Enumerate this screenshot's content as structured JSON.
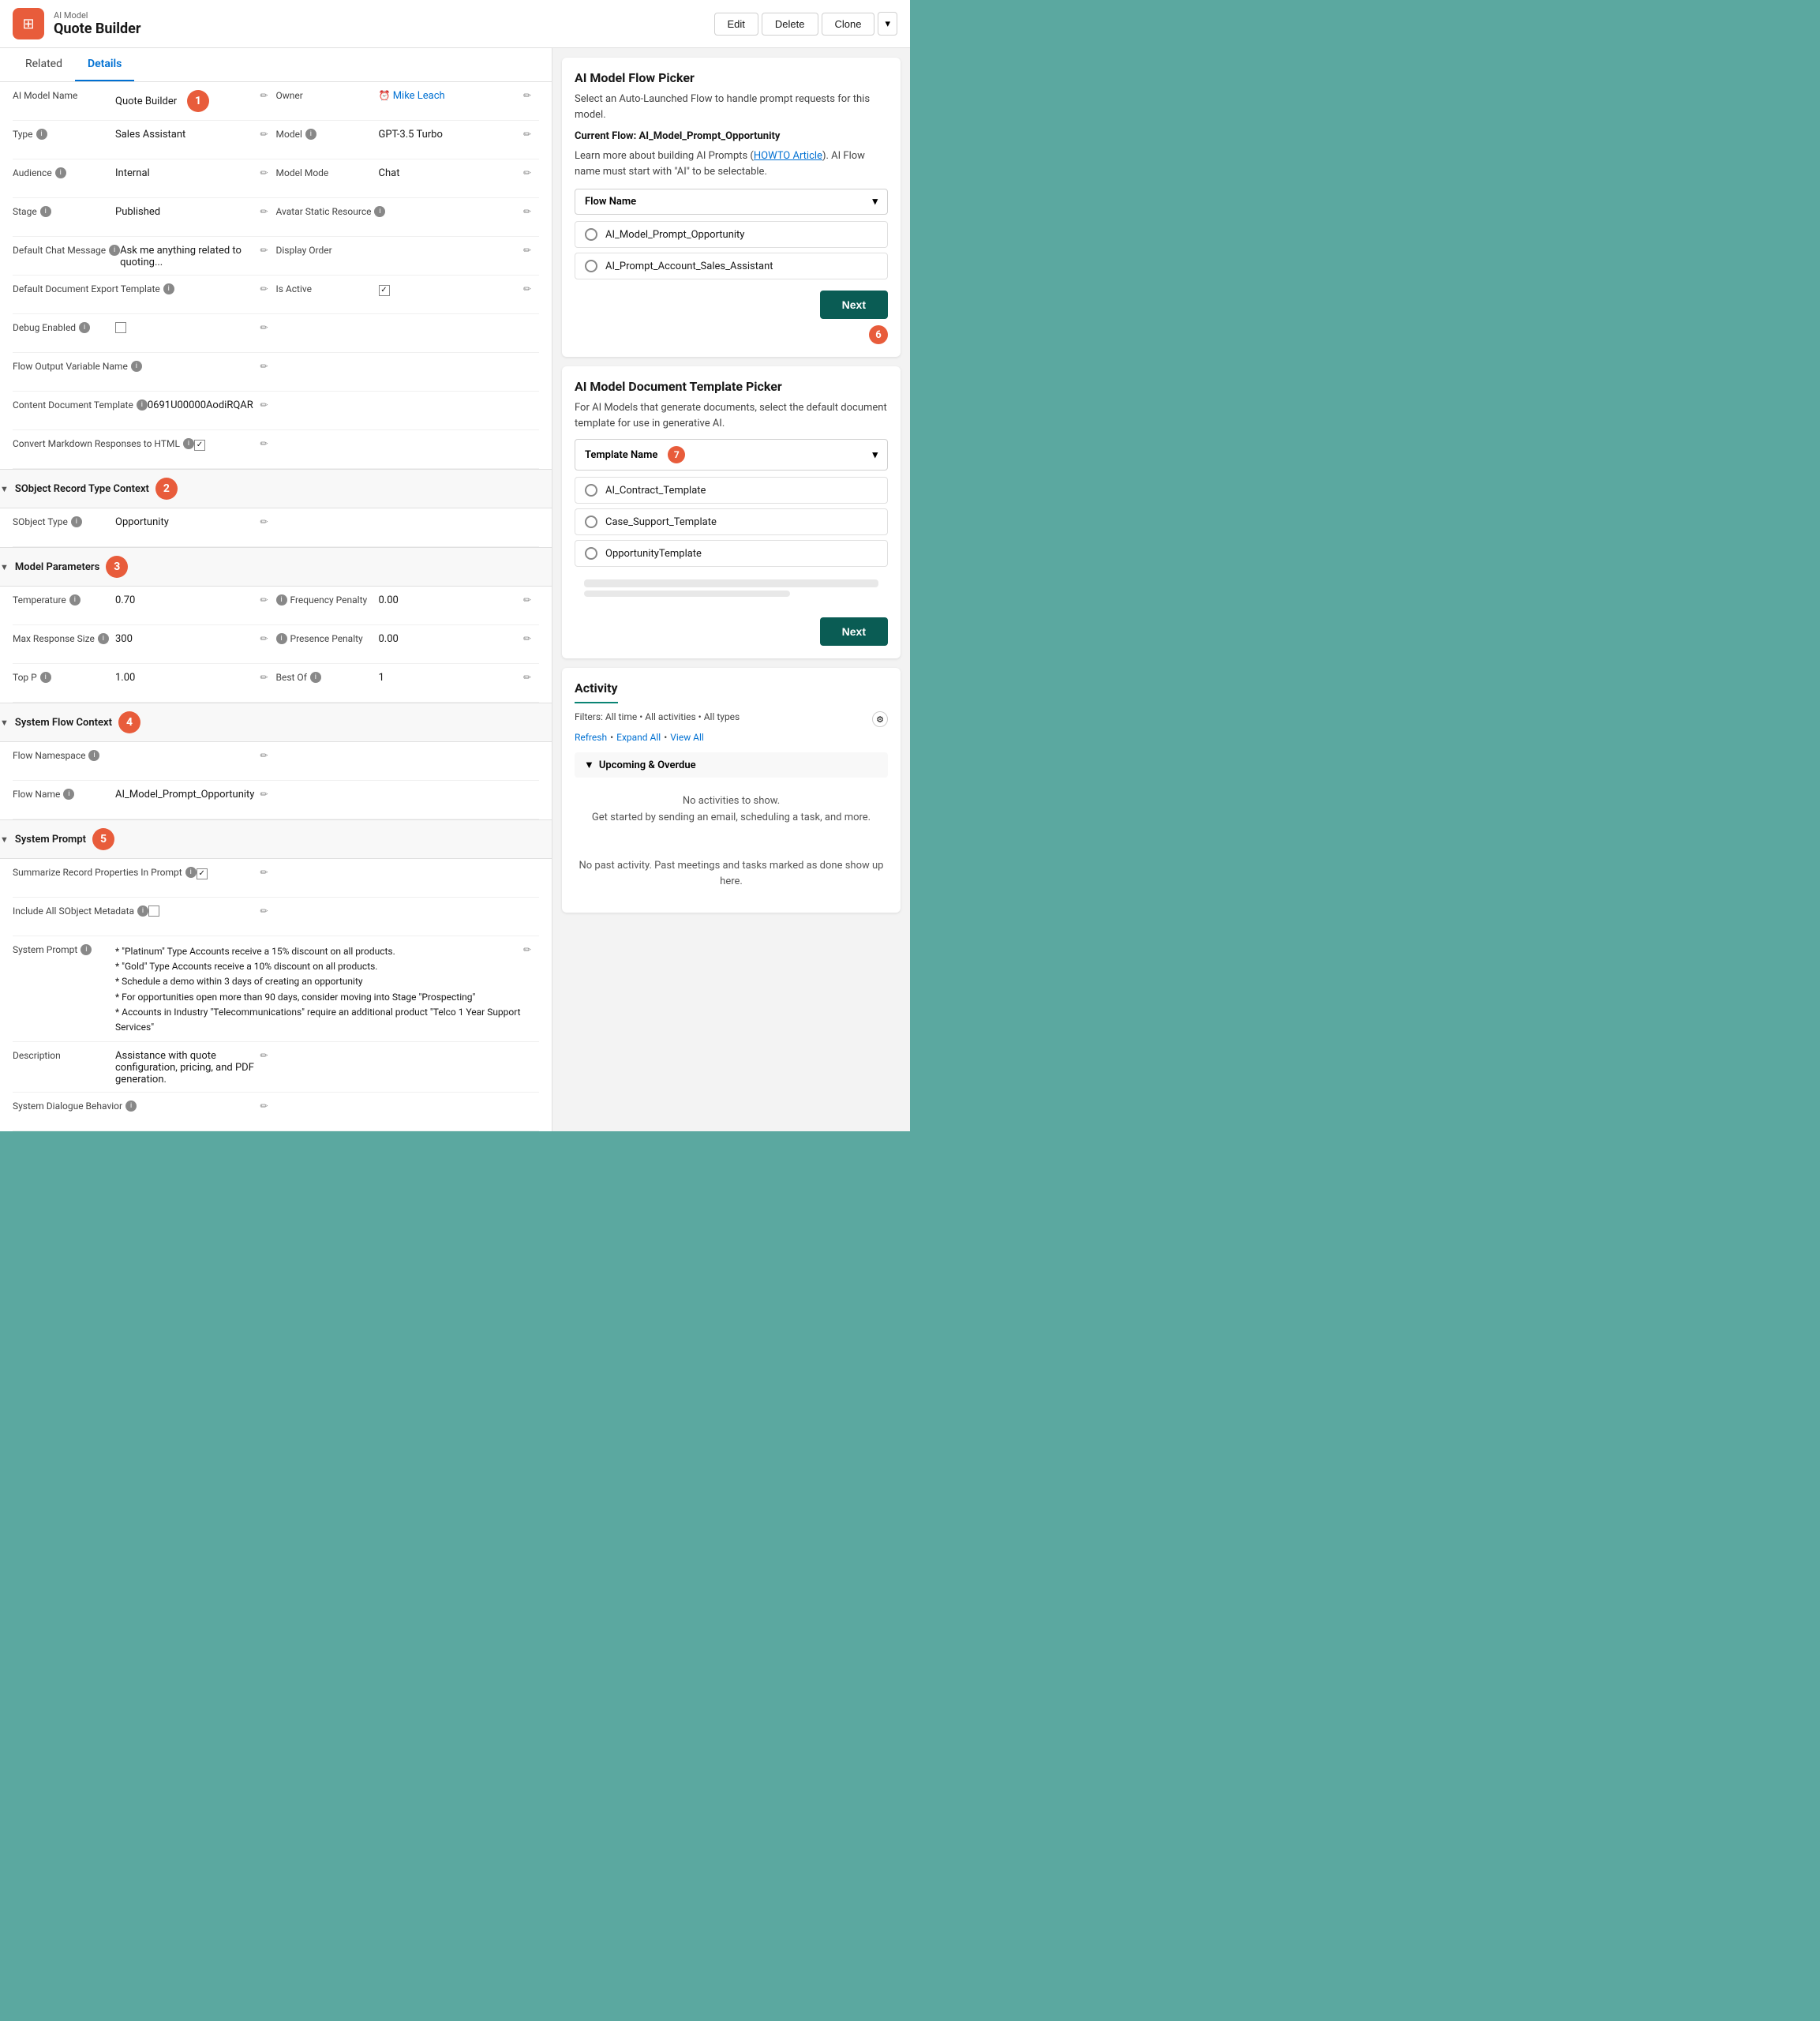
{
  "header": {
    "app_subtitle": "AI Model",
    "app_title": "Quote Builder",
    "app_icon": "⊞",
    "buttons": {
      "edit": "Edit",
      "delete": "Delete",
      "clone": "Clone"
    }
  },
  "tabs": {
    "related": "Related",
    "details": "Details",
    "active": "details"
  },
  "fields": {
    "ai_model_name_label": "AI Model Name",
    "ai_model_name_value": "Quote Builder",
    "type_label": "Type",
    "type_value": "Sales Assistant",
    "audience_label": "Audience",
    "audience_value": "Internal",
    "stage_label": "Stage",
    "stage_value": "Published",
    "default_chat_label": "Default Chat Message",
    "default_chat_value": "Ask me anything related to quoting...",
    "default_doc_export_label": "Default Document Export Template",
    "debug_enabled_label": "Debug Enabled",
    "flow_output_label": "Flow Output Variable Name",
    "content_doc_label": "Content Document Template",
    "content_doc_value": "0691U00000AodiRQAR",
    "convert_markdown_label": "Convert Markdown Responses to HTML",
    "owner_label": "Owner",
    "owner_value": "Mike Leach",
    "model_label": "Model",
    "model_value": "GPT-3.5 Turbo",
    "model_mode_label": "Model Mode",
    "model_mode_value": "Chat",
    "avatar_static_label": "Avatar Static Resource",
    "display_order_label": "Display Order",
    "is_active_label": "Is Active"
  },
  "sobject_section": {
    "title": "SObject Record Type Context",
    "sobject_type_label": "SObject Type",
    "sobject_type_value": "Opportunity"
  },
  "model_params_section": {
    "title": "Model Parameters",
    "temperature_label": "Temperature",
    "temperature_value": "0.70",
    "max_response_label": "Max Response Size",
    "max_response_value": "300",
    "top_p_label": "Top P",
    "top_p_value": "1.00",
    "frequency_penalty_label": "Frequency Penalty",
    "frequency_penalty_value": "0.00",
    "presence_penalty_label": "Presence Penalty",
    "presence_penalty_value": "0.00",
    "best_of_label": "Best Of",
    "best_of_value": "1"
  },
  "system_flow_section": {
    "title": "System Flow Context",
    "flow_namespace_label": "Flow Namespace",
    "flow_name_label": "Flow Name",
    "flow_name_value": "AI_Model_Prompt_Opportunity"
  },
  "system_prompt_section": {
    "title": "System Prompt",
    "summarize_label": "Summarize Record Properties In Prompt",
    "include_all_label": "Include All SObject Metadata",
    "system_prompt_label": "System Prompt",
    "system_prompt_value": "* \"Platinum\" Type Accounts receive a 15% discount on all products.\n* \"Gold\" Type Accounts receive a 10% discount on all products.\n* Schedule a demo within 3 days of creating an opportunity\n* For opportunities open more than 90 days, consider moving into Stage \"Prospecting\"\n* Accounts in Industry \"Telecommunications\" require an additional product \"Telco 1 Year Support Services\"",
    "description_label": "Description",
    "description_value": "Assistance with quote configuration, pricing, and PDF generation.",
    "system_dialogue_label": "System Dialogue Behavior"
  },
  "flow_picker": {
    "title": "AI Model Flow Picker",
    "desc": "Select an Auto-Launched Flow to handle prompt requests for this model.",
    "current_flow_label": "Current Flow:",
    "current_flow_value": "AI_Model_Prompt_Opportunity",
    "howto_text_pre": "Learn more about building AI Prompts (",
    "howto_link": "HOWTO Article",
    "howto_text_post": "). AI Flow name must start with \"AI\" to be selectable.",
    "dropdown_label": "Flow Name",
    "option1": "AI_Model_Prompt_Opportunity",
    "option2": "AI_Prompt_Account_Sales_Assistant",
    "next_button": "Next",
    "badge": "6"
  },
  "template_picker": {
    "title": "AI Model Document Template Picker",
    "desc": "For AI Models that generate documents, select the default document template for use in generative AI.",
    "dropdown_label": "Template Name",
    "option1": "AI_Contract_Template",
    "option2": "Case_Support_Template",
    "option3": "OpportunityTemplate",
    "next_button": "Next",
    "badge": "7"
  },
  "activity": {
    "title": "Activity",
    "filters": "Filters: All time • All activities • All types",
    "refresh": "Refresh",
    "expand_all": "Expand All",
    "view_all": "View All",
    "upcoming_header": "Upcoming & Overdue",
    "no_activity1": "No activities to show.",
    "no_activity2": "Get started by sending an email, scheduling a task, and more.",
    "no_past_activity": "No past activity. Past meetings and tasks marked as done show up here."
  },
  "badges": {
    "b1": "1",
    "b2": "2",
    "b3": "3",
    "b4": "4",
    "b5": "5"
  }
}
